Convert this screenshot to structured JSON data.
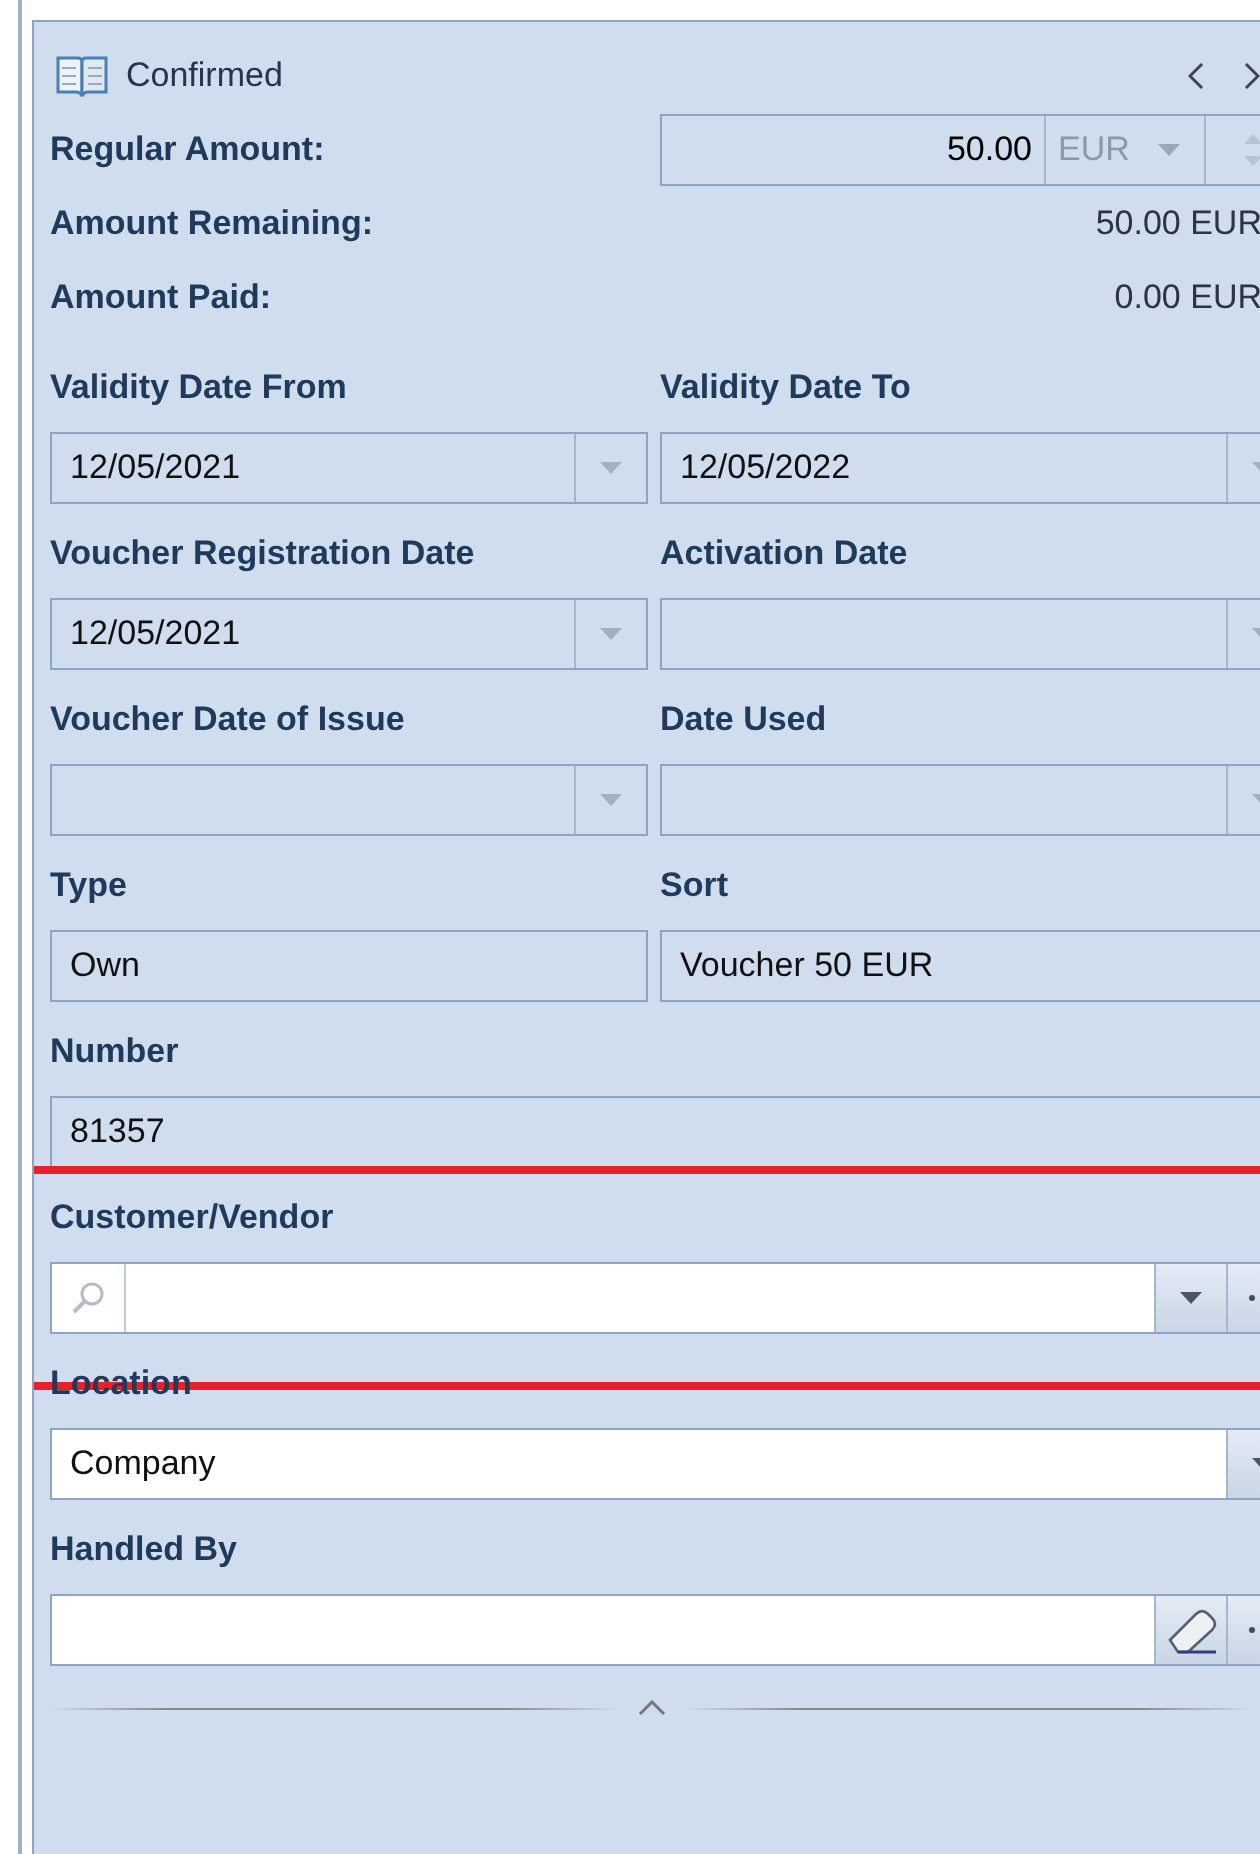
{
  "header": {
    "title": "Confirmed"
  },
  "amounts": [
    {
      "label": "Regular Amount:",
      "kind": "input",
      "value": "50.00",
      "currency": "EUR"
    },
    {
      "label": "Amount Remaining:",
      "kind": "text",
      "value": "50.00 EUR"
    },
    {
      "label": "Amount Paid:",
      "kind": "text",
      "value": "0.00 EUR"
    }
  ],
  "rows": [
    {
      "fields": [
        {
          "label": "Validity Date From",
          "kind": "date",
          "value": "12/05/2021",
          "highlighted": false
        },
        {
          "label": "Validity Date To",
          "kind": "date",
          "value": "12/05/2022",
          "highlighted": false
        }
      ]
    },
    {
      "fields": [
        {
          "label": "Voucher Registration Date",
          "kind": "date",
          "value": "12/05/2021",
          "highlighted": false
        },
        {
          "label": "Activation Date",
          "kind": "date",
          "highlighted": false
        }
      ]
    },
    {
      "fields": [
        {
          "label": "Voucher Date of Issue",
          "kind": "date",
          "highlighted": false
        },
        {
          "label": "Date Used",
          "kind": "date",
          "highlighted": false
        }
      ]
    },
    {
      "fields": [
        {
          "label": "Type",
          "kind": "text",
          "value": "Own",
          "highlighted": false
        },
        {
          "label": "Sort",
          "kind": "text",
          "value": "Voucher 50 EUR",
          "highlighted": false
        }
      ]
    },
    {
      "fields": [
        {
          "label": "Number",
          "kind": "text",
          "value": "81357",
          "highlighted": false
        }
      ]
    },
    {
      "fields": [
        {
          "label": "Customer/Vendor",
          "kind": "lookup",
          "highlighted": true
        }
      ]
    },
    {
      "fields": [
        {
          "label": "Location",
          "kind": "combo",
          "value": "Company",
          "highlighted": false
        }
      ]
    },
    {
      "fields": [
        {
          "label": "Handled By",
          "kind": "picker",
          "highlighted": false
        }
      ]
    }
  ]
}
